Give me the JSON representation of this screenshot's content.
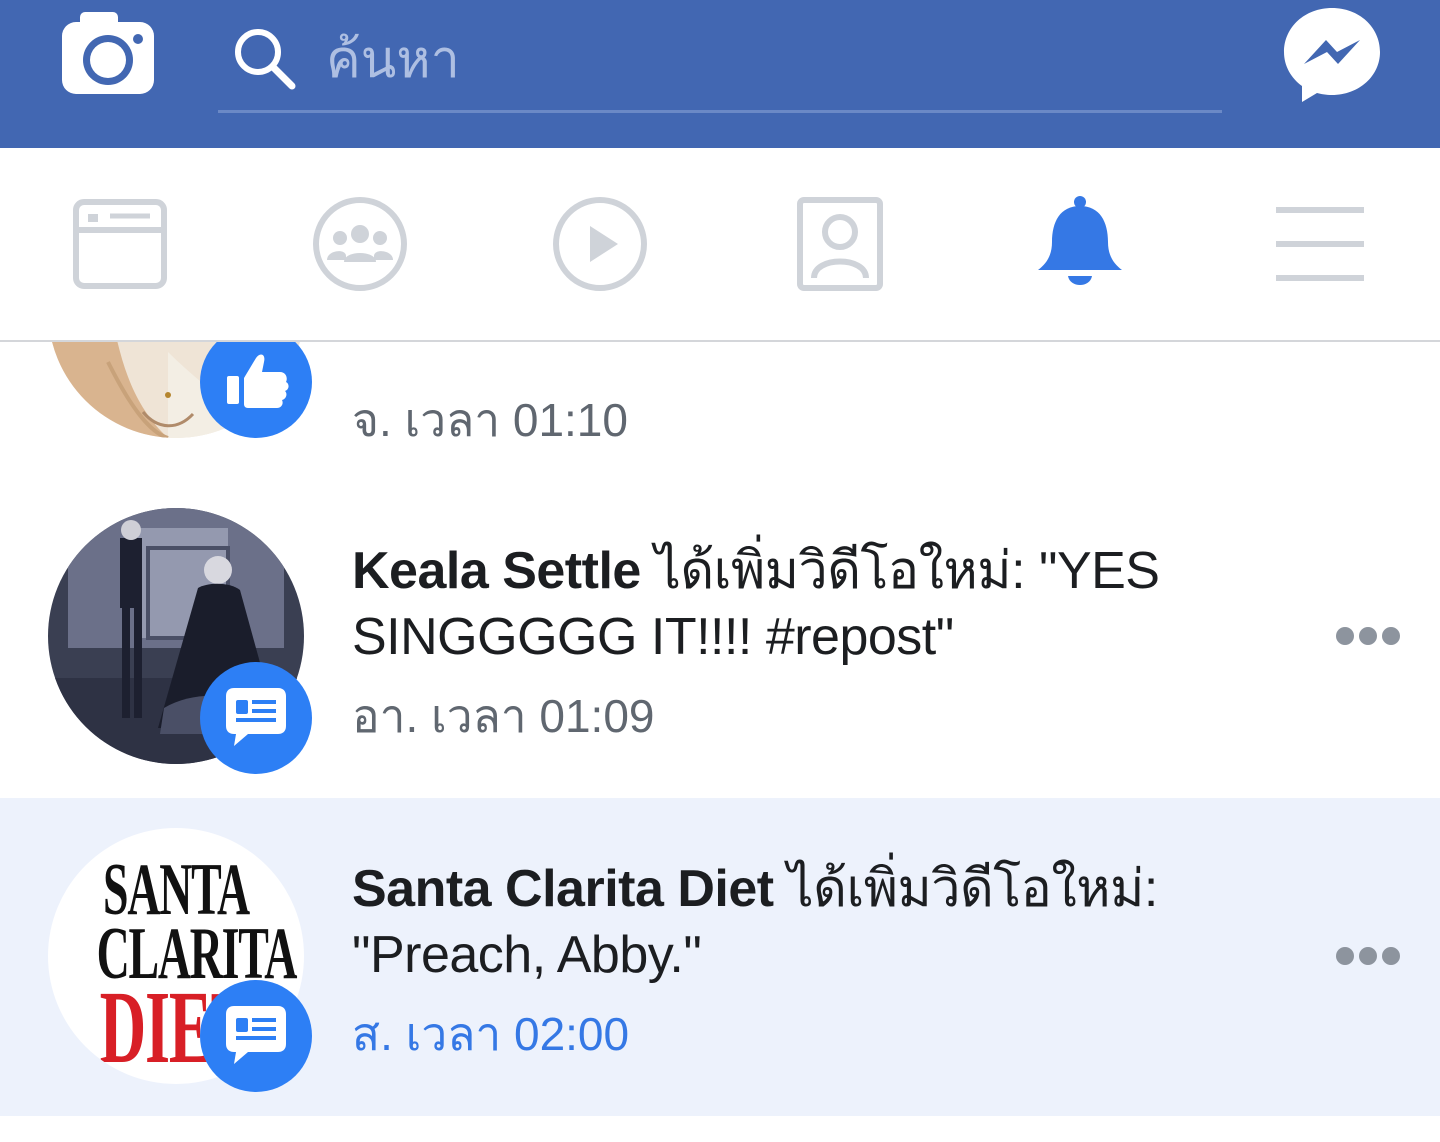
{
  "search": {
    "placeholder": "ค้นหา"
  },
  "tabs": [
    {
      "id": "news-feed",
      "active": false
    },
    {
      "id": "groups",
      "active": false
    },
    {
      "id": "watch",
      "active": false
    },
    {
      "id": "profile",
      "active": false
    },
    {
      "id": "notifications",
      "active": true
    },
    {
      "id": "menu",
      "active": false
    }
  ],
  "colors": {
    "brand": "#4267b2",
    "active_tab": "#3578e5",
    "inactive_tab": "#cfd3d9",
    "badge": "#2d7ff5",
    "unread_bg": "#edf2fc",
    "time_read": "#606770",
    "time_unread": "#3578e5"
  },
  "notifications": [
    {
      "badge_icon": "like-icon",
      "actor": "",
      "text": "",
      "time": "จ. เวลา 01:10",
      "unread": false
    },
    {
      "badge_icon": "comment-icon",
      "actor": "Keala Settle",
      "text_line1": " ได้เพิ่มวิดีโอใหม่: \"YES",
      "text_line2": "SINGGGGG IT!!!! #repost\"",
      "time": "อา. เวลา 01:09",
      "unread": false
    },
    {
      "badge_icon": "comment-icon",
      "actor": "Santa Clarita Diet",
      "text_line1": " ได้เพิ่มวิดีโอใหม่:",
      "text_line2": "\"Preach, Abby.\"",
      "time": "ส. เวลา 02:00",
      "unread": true,
      "logo": {
        "line1": "SANTA",
        "line2": "CLARITA",
        "line3": "DIET"
      }
    }
  ]
}
